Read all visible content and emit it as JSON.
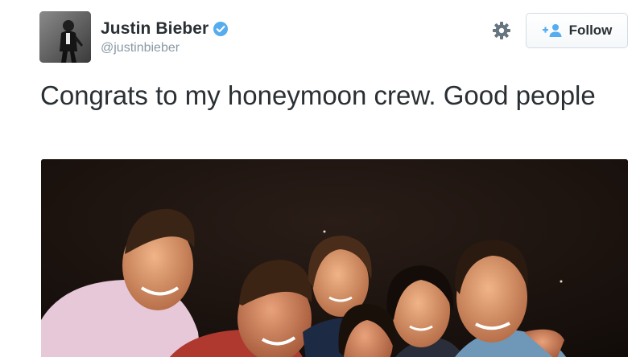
{
  "author": {
    "display_name": "Justin Bieber",
    "handle": "@justinbieber",
    "verified": true
  },
  "actions": {
    "settings_icon": "gear-icon",
    "follow_label": "Follow",
    "follow_icon": "add-user-icon"
  },
  "tweet": {
    "text": "Congrats to my honeymoon crew. Good people"
  },
  "colors": {
    "text": "#292f33",
    "muted": "#8899a6",
    "verified_blue": "#55acee",
    "follow_icon_blue": "#55acee",
    "photo_background": "#1b130f"
  }
}
